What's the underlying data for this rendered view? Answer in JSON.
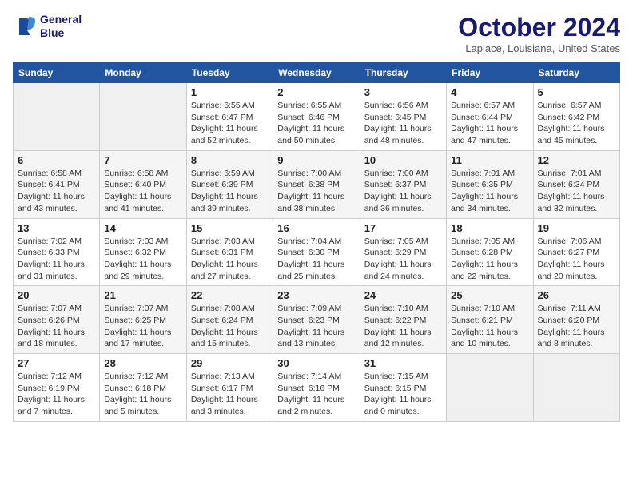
{
  "header": {
    "logo_line1": "General",
    "logo_line2": "Blue",
    "month": "October 2024",
    "location": "Laplace, Louisiana, United States"
  },
  "days_of_week": [
    "Sunday",
    "Monday",
    "Tuesday",
    "Wednesday",
    "Thursday",
    "Friday",
    "Saturday"
  ],
  "weeks": [
    [
      {
        "day": "",
        "content": ""
      },
      {
        "day": "",
        "content": ""
      },
      {
        "day": "1",
        "content": "Sunrise: 6:55 AM\nSunset: 6:47 PM\nDaylight: 11 hours and 52 minutes."
      },
      {
        "day": "2",
        "content": "Sunrise: 6:55 AM\nSunset: 6:46 PM\nDaylight: 11 hours and 50 minutes."
      },
      {
        "day": "3",
        "content": "Sunrise: 6:56 AM\nSunset: 6:45 PM\nDaylight: 11 hours and 48 minutes."
      },
      {
        "day": "4",
        "content": "Sunrise: 6:57 AM\nSunset: 6:44 PM\nDaylight: 11 hours and 47 minutes."
      },
      {
        "day": "5",
        "content": "Sunrise: 6:57 AM\nSunset: 6:42 PM\nDaylight: 11 hours and 45 minutes."
      }
    ],
    [
      {
        "day": "6",
        "content": "Sunrise: 6:58 AM\nSunset: 6:41 PM\nDaylight: 11 hours and 43 minutes."
      },
      {
        "day": "7",
        "content": "Sunrise: 6:58 AM\nSunset: 6:40 PM\nDaylight: 11 hours and 41 minutes."
      },
      {
        "day": "8",
        "content": "Sunrise: 6:59 AM\nSunset: 6:39 PM\nDaylight: 11 hours and 39 minutes."
      },
      {
        "day": "9",
        "content": "Sunrise: 7:00 AM\nSunset: 6:38 PM\nDaylight: 11 hours and 38 minutes."
      },
      {
        "day": "10",
        "content": "Sunrise: 7:00 AM\nSunset: 6:37 PM\nDaylight: 11 hours and 36 minutes."
      },
      {
        "day": "11",
        "content": "Sunrise: 7:01 AM\nSunset: 6:35 PM\nDaylight: 11 hours and 34 minutes."
      },
      {
        "day": "12",
        "content": "Sunrise: 7:01 AM\nSunset: 6:34 PM\nDaylight: 11 hours and 32 minutes."
      }
    ],
    [
      {
        "day": "13",
        "content": "Sunrise: 7:02 AM\nSunset: 6:33 PM\nDaylight: 11 hours and 31 minutes."
      },
      {
        "day": "14",
        "content": "Sunrise: 7:03 AM\nSunset: 6:32 PM\nDaylight: 11 hours and 29 minutes."
      },
      {
        "day": "15",
        "content": "Sunrise: 7:03 AM\nSunset: 6:31 PM\nDaylight: 11 hours and 27 minutes."
      },
      {
        "day": "16",
        "content": "Sunrise: 7:04 AM\nSunset: 6:30 PM\nDaylight: 11 hours and 25 minutes."
      },
      {
        "day": "17",
        "content": "Sunrise: 7:05 AM\nSunset: 6:29 PM\nDaylight: 11 hours and 24 minutes."
      },
      {
        "day": "18",
        "content": "Sunrise: 7:05 AM\nSunset: 6:28 PM\nDaylight: 11 hours and 22 minutes."
      },
      {
        "day": "19",
        "content": "Sunrise: 7:06 AM\nSunset: 6:27 PM\nDaylight: 11 hours and 20 minutes."
      }
    ],
    [
      {
        "day": "20",
        "content": "Sunrise: 7:07 AM\nSunset: 6:26 PM\nDaylight: 11 hours and 18 minutes."
      },
      {
        "day": "21",
        "content": "Sunrise: 7:07 AM\nSunset: 6:25 PM\nDaylight: 11 hours and 17 minutes."
      },
      {
        "day": "22",
        "content": "Sunrise: 7:08 AM\nSunset: 6:24 PM\nDaylight: 11 hours and 15 minutes."
      },
      {
        "day": "23",
        "content": "Sunrise: 7:09 AM\nSunset: 6:23 PM\nDaylight: 11 hours and 13 minutes."
      },
      {
        "day": "24",
        "content": "Sunrise: 7:10 AM\nSunset: 6:22 PM\nDaylight: 11 hours and 12 minutes."
      },
      {
        "day": "25",
        "content": "Sunrise: 7:10 AM\nSunset: 6:21 PM\nDaylight: 11 hours and 10 minutes."
      },
      {
        "day": "26",
        "content": "Sunrise: 7:11 AM\nSunset: 6:20 PM\nDaylight: 11 hours and 8 minutes."
      }
    ],
    [
      {
        "day": "27",
        "content": "Sunrise: 7:12 AM\nSunset: 6:19 PM\nDaylight: 11 hours and 7 minutes."
      },
      {
        "day": "28",
        "content": "Sunrise: 7:12 AM\nSunset: 6:18 PM\nDaylight: 11 hours and 5 minutes."
      },
      {
        "day": "29",
        "content": "Sunrise: 7:13 AM\nSunset: 6:17 PM\nDaylight: 11 hours and 3 minutes."
      },
      {
        "day": "30",
        "content": "Sunrise: 7:14 AM\nSunset: 6:16 PM\nDaylight: 11 hours and 2 minutes."
      },
      {
        "day": "31",
        "content": "Sunrise: 7:15 AM\nSunset: 6:15 PM\nDaylight: 11 hours and 0 minutes."
      },
      {
        "day": "",
        "content": ""
      },
      {
        "day": "",
        "content": ""
      }
    ]
  ]
}
